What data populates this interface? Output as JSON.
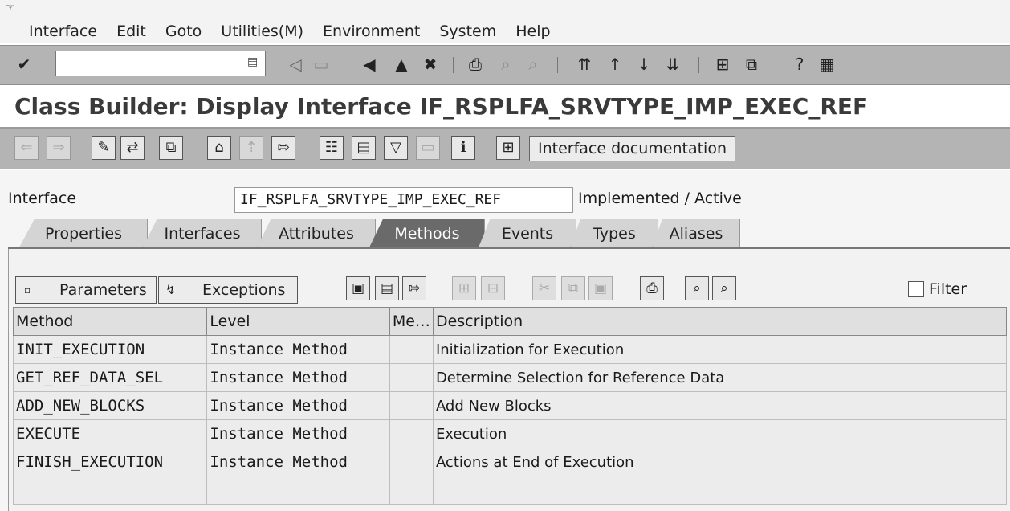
{
  "menu": [
    "Interface",
    "Edit",
    "Goto",
    "Utilities(M)",
    "Environment",
    "System",
    "Help"
  ],
  "command_field": {
    "value": ""
  },
  "title": "Class Builder: Display Interface IF_RSPLFA_SRVTYPE_IMP_EXEC_REF",
  "app_toolbar": {
    "interface_doc_label": "Interface documentation"
  },
  "interface": {
    "label": "Interface",
    "name": "IF_RSPLFA_SRVTYPE_IMP_EXEC_REF",
    "status": "Implemented / Active"
  },
  "tabs": [
    {
      "label": "Properties",
      "active": false
    },
    {
      "label": "Interfaces",
      "active": false
    },
    {
      "label": "Attributes",
      "active": false
    },
    {
      "label": "Methods",
      "active": true
    },
    {
      "label": "Events",
      "active": false
    },
    {
      "label": "Types",
      "active": false
    },
    {
      "label": "Aliases",
      "active": false
    }
  ],
  "methods_toolbar": {
    "parameters_label": "Parameters",
    "exceptions_label": "Exceptions",
    "filter_label": "Filter",
    "filter_checked": false
  },
  "table": {
    "columns": [
      "Method",
      "Level",
      "Me…",
      "Description"
    ],
    "rows": [
      {
        "method": "INIT_EXECUTION",
        "level": "Instance Method",
        "me": "",
        "description": "Initialization for Execution"
      },
      {
        "method": "GET_REF_DATA_SEL",
        "level": "Instance Method",
        "me": "",
        "description": "Determine Selection for Reference Data"
      },
      {
        "method": "ADD_NEW_BLOCKS",
        "level": "Instance Method",
        "me": "",
        "description": "Add New Blocks"
      },
      {
        "method": "EXECUTE",
        "level": "Instance Method",
        "me": "",
        "description": "Execution"
      },
      {
        "method": "FINISH_EXECUTION",
        "level": "Instance Method",
        "me": "",
        "description": "Actions at End of Execution"
      },
      {
        "method": "",
        "level": "",
        "me": "",
        "description": ""
      }
    ]
  }
}
